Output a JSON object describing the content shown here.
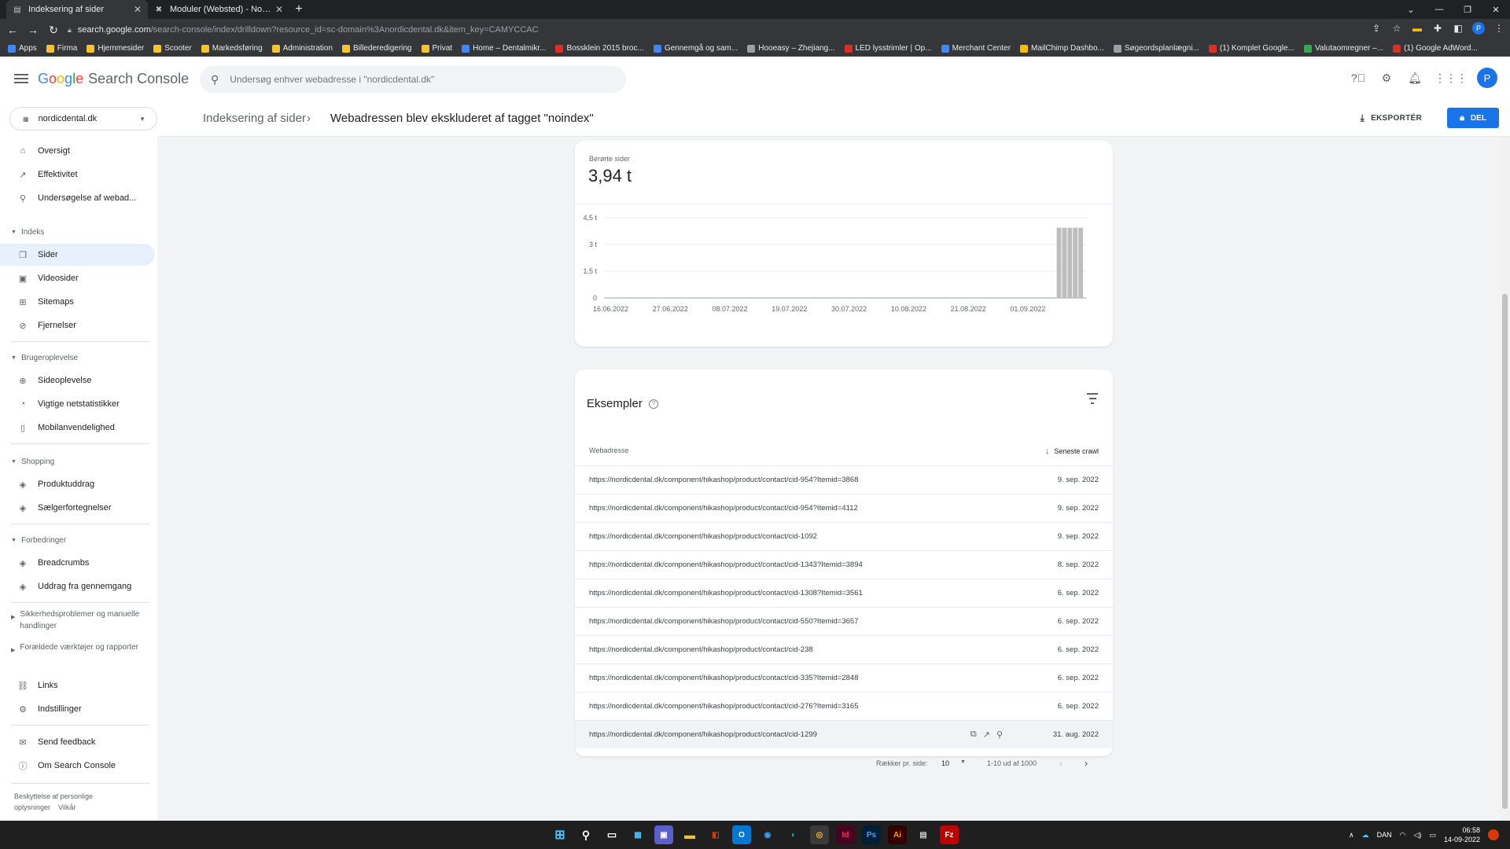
{
  "browser": {
    "tabs": [
      {
        "title": "Indeksering af sider",
        "active": true
      },
      {
        "title": "Moduler (Websted) - Nordic Den",
        "active": false
      }
    ],
    "url_host": "search.google.com",
    "url_path": "/search-console/index/drilldown?resource_id=sc-domain%3Anordicdental.dk&item_key=CAMYCCAC",
    "bookmarks": [
      "Apps",
      "Firma",
      "Hjemmesider",
      "Scooter",
      "Markedsføring",
      "Administration",
      "Billederedigering",
      "Privat",
      "Home – Dentalmikr...",
      "Bossklein 2015 broc...",
      "Gennemgå og sam...",
      "Hooeasy – Zhejiang...",
      "LED lysstrimler | Op...",
      "Merchant Center",
      "MailChimp Dashbo...",
      "Søgeordsplanlægni...",
      "(1) Komplet Google...",
      "Valutaomregner –...",
      "(1) Google AdWord..."
    ]
  },
  "header": {
    "logo_google": [
      "G",
      "o",
      "o",
      "g",
      "l",
      "e"
    ],
    "logo_product": "Search Console",
    "search_placeholder": "Undersøg enhver webadresse i \"nordicdental.dk\"",
    "avatar_letter": "P"
  },
  "sidebar": {
    "property": "nordicdental.dk",
    "items": [
      {
        "label": "Oversigt",
        "icon": "home-icon"
      },
      {
        "label": "Effektivitet",
        "icon": "trending-icon"
      },
      {
        "label": "Undersøgelse af webad...",
        "icon": "search-icon"
      }
    ],
    "sections": [
      {
        "title": "Indeks",
        "items": [
          {
            "label": "Sider",
            "icon": "pages-icon",
            "selected": true
          },
          {
            "label": "Videosider",
            "icon": "video-icon"
          },
          {
            "label": "Sitemaps",
            "icon": "sitemap-icon"
          },
          {
            "label": "Fjernelser",
            "icon": "removal-icon"
          }
        ]
      },
      {
        "title": "Brugeroplevelse",
        "items": [
          {
            "label": "Sideoplevelse",
            "icon": "plus-circle-icon"
          },
          {
            "label": "Vigtige netstatistikker",
            "icon": "gauge-icon"
          },
          {
            "label": "Mobilanvendelighed",
            "icon": "phone-icon"
          }
        ]
      },
      {
        "title": "Shopping",
        "items": [
          {
            "label": "Produktuddrag",
            "icon": "layers-icon"
          },
          {
            "label": "Sælgerfortegnelser",
            "icon": "layers-icon"
          }
        ]
      },
      {
        "title": "Forbedringer",
        "items": [
          {
            "label": "Breadcrumbs",
            "icon": "layers-icon"
          },
          {
            "label": "Uddrag fra gennemgang",
            "icon": "layers-icon"
          }
        ]
      }
    ],
    "security_section": "Sikkerhedsproblemer og manuelle handlinger",
    "legacy_section": "Forældede værktøjer og rapporter",
    "bottom_items": [
      {
        "label": "Links",
        "icon": "links-icon"
      },
      {
        "label": "Indstillinger",
        "icon": "settings-icon"
      },
      {
        "label": "Send feedback",
        "icon": "feedback-icon"
      },
      {
        "label": "Om Search Console",
        "icon": "info-icon"
      }
    ],
    "footer_privacy": "Beskyttelse af personlige oplysninger",
    "footer_terms": "Vilkår"
  },
  "page": {
    "breadcrumb_parent": "Indeksering af sider",
    "breadcrumb_sep": "›",
    "title": "Webadressen blev ekskluderet af tagget \"noindex\"",
    "export_label": "EKSPORTÉR",
    "share_label": "DEL"
  },
  "summary": {
    "metric_label": "Berørte sider",
    "metric_value": "3,94 t"
  },
  "chart_data": {
    "type": "bar",
    "title": "",
    "xlabel": "",
    "ylabel": "",
    "ylim": [
      0,
      4500
    ],
    "y_ticks": [
      {
        "value": 0,
        "label": "0"
      },
      {
        "value": 1500,
        "label": "1,5 t"
      },
      {
        "value": 3000,
        "label": "3 t"
      },
      {
        "value": 4500,
        "label": "4,5 t"
      }
    ],
    "x_tick_labels": [
      "16.06.2022",
      "27.06.2022",
      "08.07.2022",
      "19.07.2022",
      "30.07.2022",
      "10.08.2022",
      "21.08.2022",
      "01.09.2022"
    ],
    "x_range_days": [
      0,
      89
    ],
    "x_tick_days": [
      0,
      11,
      22,
      33,
      44,
      55,
      66,
      77
    ],
    "bars": [
      {
        "day": 84,
        "value": 3940
      },
      {
        "day": 85,
        "value": 3940
      },
      {
        "day": 86,
        "value": 3940
      },
      {
        "day": 87,
        "value": 3940
      },
      {
        "day": 88,
        "value": 3940
      }
    ],
    "bar_color": "#bdbdbd",
    "grid": true
  },
  "examples": {
    "title": "Eksempler",
    "col_url": "Webadresse",
    "col_date": "Seneste crawl",
    "rows": [
      {
        "url": "https://nordicdental.dk/component/hikashop/product/contact/cid-954?Itemid=3868",
        "date": "9. sep. 2022"
      },
      {
        "url": "https://nordicdental.dk/component/hikashop/product/contact/cid-954?Itemid=4112",
        "date": "9. sep. 2022"
      },
      {
        "url": "https://nordicdental.dk/component/hikashop/product/contact/cid-1092",
        "date": "9. sep. 2022"
      },
      {
        "url": "https://nordicdental.dk/component/hikashop/product/contact/cid-1343?Itemid=3894",
        "date": "8. sep. 2022"
      },
      {
        "url": "https://nordicdental.dk/component/hikashop/product/contact/cid-1308?Itemid=3561",
        "date": "6. sep. 2022"
      },
      {
        "url": "https://nordicdental.dk/component/hikashop/product/contact/cid-550?Itemid=3657",
        "date": "6. sep. 2022"
      },
      {
        "url": "https://nordicdental.dk/component/hikashop/product/contact/cid-238",
        "date": "6. sep. 2022"
      },
      {
        "url": "https://nordicdental.dk/component/hikashop/product/contact/cid-335?Itemid=2848",
        "date": "6. sep. 2022"
      },
      {
        "url": "https://nordicdental.dk/component/hikashop/product/contact/cid-276?Itemid=3165",
        "date": "6. sep. 2022"
      },
      {
        "url": "https://nordicdental.dk/component/hikashop/product/contact/cid-1299",
        "date": "31. aug. 2022"
      }
    ],
    "rows_per_page_label": "Rækker pr. side:",
    "rows_per_page": "10",
    "range": "1-10 ud af 1000"
  },
  "taskbar": {
    "lang": "DAN",
    "time": "06:58",
    "date": "14-09-2022"
  }
}
